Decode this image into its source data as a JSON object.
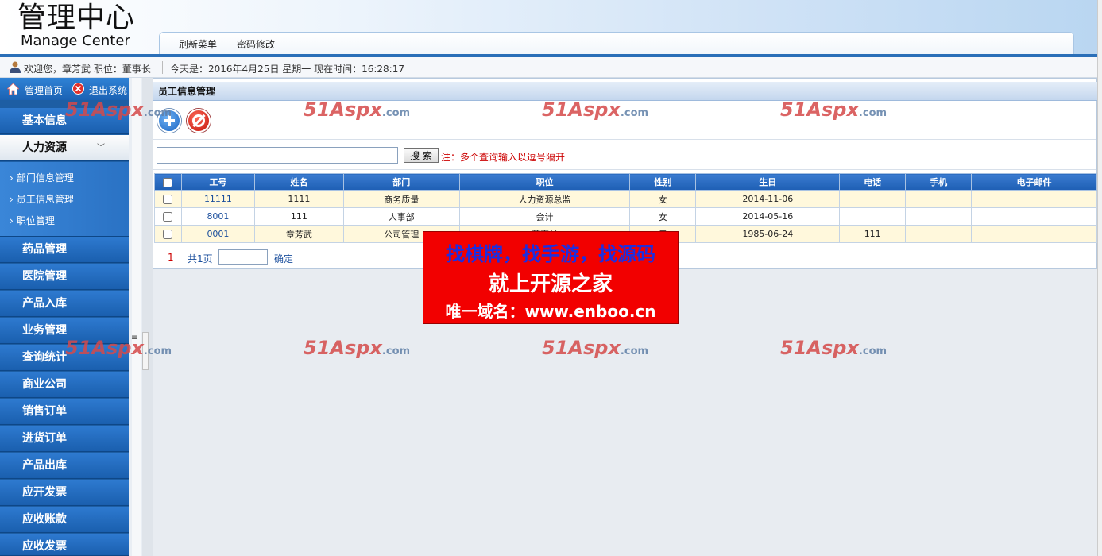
{
  "header": {
    "logo_cn": "管理中心",
    "logo_en": "Manage Center",
    "nav": [
      "刷新菜单",
      "密码修改"
    ]
  },
  "infobar": {
    "welcome": "欢迎您，章芳武 职位：董事长",
    "today": "今天是：2016年4月25日 星期一  现在时间：16:28:17"
  },
  "sidebar": {
    "top_links": [
      "管理首页",
      "退出系统"
    ],
    "sections_top": [
      "基本信息",
      "人力资源"
    ],
    "sub_items": [
      "部门信息管理",
      "员工信息管理",
      "职位管理"
    ],
    "sections": [
      "药品管理",
      "医院管理",
      "产品入库",
      "业务管理",
      "查询统计",
      "商业公司",
      "销售订单",
      "进货订单",
      "产品出库",
      "应开发票",
      "应收账款",
      "应收发票"
    ]
  },
  "panel": {
    "title": "员工信息管理",
    "search_value": "",
    "search_button": "搜 索",
    "search_note": "注：多个查询输入以逗号隔开"
  },
  "table": {
    "columns": [
      "工号",
      "姓名",
      "部门",
      "职位",
      "性别",
      "生日",
      "电话",
      "手机",
      "电子邮件"
    ],
    "rows": [
      [
        "11111",
        "1111",
        "商务质量",
        "人力资源总监",
        "女",
        "2014-11-06",
        "",
        "",
        ""
      ],
      [
        "8001",
        "111",
        "人事部",
        "会计",
        "女",
        "2014-05-16",
        "",
        "",
        ""
      ],
      [
        "0001",
        "章芳武",
        "公司管理",
        "董事长",
        "男",
        "1985-06-24",
        "111",
        "",
        ""
      ]
    ]
  },
  "pager": {
    "current": "1",
    "total": "共1页",
    "go": "确定"
  },
  "watermark": {
    "main": "51Aspx",
    "suffix": ".com"
  },
  "banner": {
    "line1": "找棋牌，找手游，找源码",
    "line2": "就上开源之家",
    "line3": "唯一域名：www.enboo.cn"
  },
  "colors": {
    "accent": "#1d5ea4",
    "header_bar": "#2a6fb8",
    "banner_bg": "#f20000",
    "note": "#cc0000"
  }
}
